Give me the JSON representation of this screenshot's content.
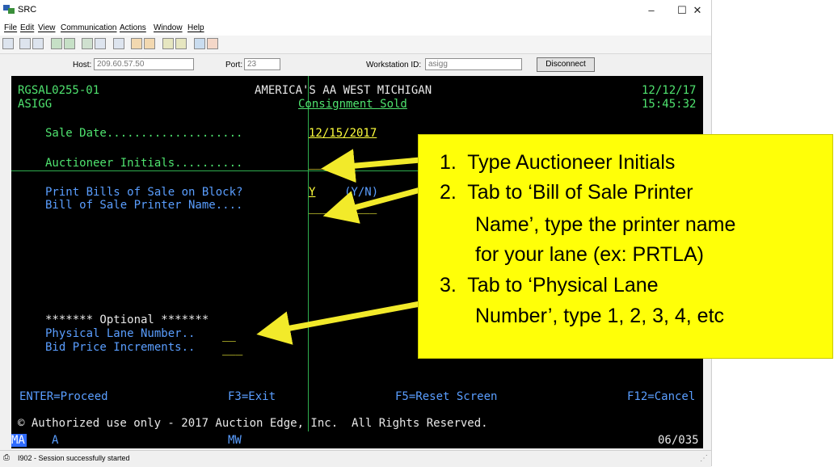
{
  "window": {
    "title": "SRC",
    "controls": {
      "minimize": "–",
      "maximize": "☐",
      "close": "✕"
    }
  },
  "menu": [
    "File",
    "Edit",
    "View",
    "Communication",
    "Actions",
    "Window",
    "Help"
  ],
  "info": {
    "host_label": "Host:",
    "host_value": "209.60.57.50",
    "port_label": "Port:",
    "port_value": "23",
    "ws_label": "Workstation ID:",
    "ws_value": "asigg",
    "disconnect_label": "Disconnect"
  },
  "terminal": {
    "program": "RGSAL0255-01",
    "company": "AMERICA'S AA WEST MICHIGAN",
    "date": "12/12/17",
    "user": "ASIGG",
    "screen_title": "Consignment Sold",
    "time": "15:45:32",
    "sale_date_label": "Sale Date....................",
    "sale_date_value": "12/15/2017",
    "auctioneer_label": "Auctioneer Initials..........",
    "auctioneer_value": "__",
    "print_bills_label": "Print Bills of Sale on Block?",
    "print_bills_value": "Y",
    "print_bills_hint": "(Y/N)",
    "printer_label": "Bill of Sale Printer Name....",
    "printer_value": "__________",
    "optional_label": "******* Optional *******",
    "lane_label": "Physical Lane Number..",
    "lane_value": "__",
    "bid_label": "Bid Price Increments..",
    "bid_value": "___",
    "fkeys": {
      "enter": "ENTER=Proceed",
      "f3": "F3=Exit",
      "f5": "F5=Reset Screen",
      "f12": "F12=Cancel"
    },
    "copyright": "© Authorized use only - 2017 Auction Edge, Inc.  All Rights Reserved.",
    "status_ma": "MA",
    "status_a": "A",
    "status_mw": "MW",
    "cursor_pos": "06/035"
  },
  "statusbar": {
    "message": "I902 - Session successfully started"
  },
  "callout": {
    "step1": "1.  Type Auctioneer Initials",
    "step2a": "2.  Tab to ‘Bill of Sale Printer",
    "step2b": "Name’, type the printer name",
    "step2c": "for your lane (ex: PRTLA)",
    "step3a": "3.  Tab to ‘Physical Lane",
    "step3b": "Number’, type 1, 2, 3, 4, etc"
  },
  "colors": {
    "terminal_green": "#4fe36f",
    "terminal_blue": "#5a9eff",
    "terminal_yellow": "#ffff3c",
    "callout": "#ffff08",
    "arrow": "#f2ea2a"
  }
}
